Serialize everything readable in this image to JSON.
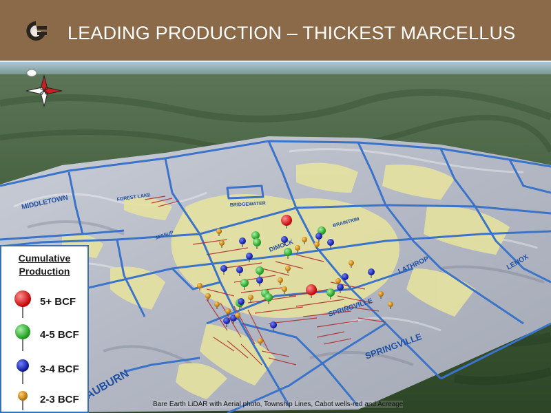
{
  "header": {
    "title": "LEADING PRODUCTION – THICKEST MARCELLUS",
    "logo_icon": "cabot-logo-icon",
    "background_color": "#8a6a48"
  },
  "map": {
    "compass_icon": "compass-rose-icon",
    "township_labels": [
      "MIDDLETOWN",
      "FOREST LAKE",
      "JESSUP",
      "BRIDGEWATER",
      "DIMOCK",
      "BRAINTRIM",
      "LATHROP",
      "SPRINGVILLE",
      "SPRINGVILLE",
      "LENOX",
      "AUBURN"
    ],
    "colors": {
      "township_lines": "#3a73c8",
      "acreage": "#e6e2a0",
      "wells": "#b03030"
    }
  },
  "legend": {
    "title_line1": "Cumulative",
    "title_line2": "Production",
    "items": [
      {
        "label": "5+ BCF",
        "color": "#e01010"
      },
      {
        "label": "4-5 BCF",
        "color": "#22b322"
      },
      {
        "label": "3-4 BCF",
        "color": "#1a24b8"
      },
      {
        "label": "2-3 BCF",
        "color": "#d08a10"
      }
    ]
  },
  "caption": "Bare Earth LiDAR with Aerial photo, Township Lines, Cabot wells-red and Acreage"
}
